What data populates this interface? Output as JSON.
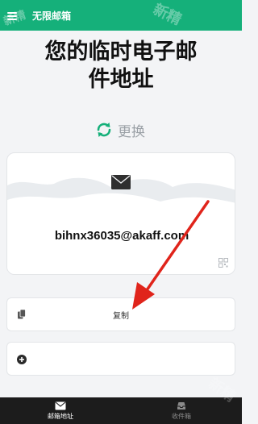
{
  "app": {
    "title": "无限邮箱",
    "accent": "#15b07a"
  },
  "headline": {
    "line1": "您的临时电子邮",
    "line2": "件地址"
  },
  "refresh": {
    "label": "更换",
    "icon": "refresh-icon"
  },
  "card": {
    "email": "bihnx36035@akaff.com",
    "icons": [
      "mail-icon",
      "qr-code-icon"
    ]
  },
  "copy_button": {
    "label": "复制",
    "icon": "copy-icon"
  },
  "add_box": {
    "icon": "plus-circle-icon"
  },
  "bottom_nav": {
    "items": [
      {
        "label": "邮箱地址",
        "icon": "mail-icon",
        "active": true
      },
      {
        "label": "收件箱",
        "icon": "inbox-icon",
        "active": false
      }
    ]
  },
  "watermark": {
    "text": "新精"
  },
  "colors": {
    "arrow": "#e0241b",
    "nav_bg": "#1c1c1c"
  }
}
